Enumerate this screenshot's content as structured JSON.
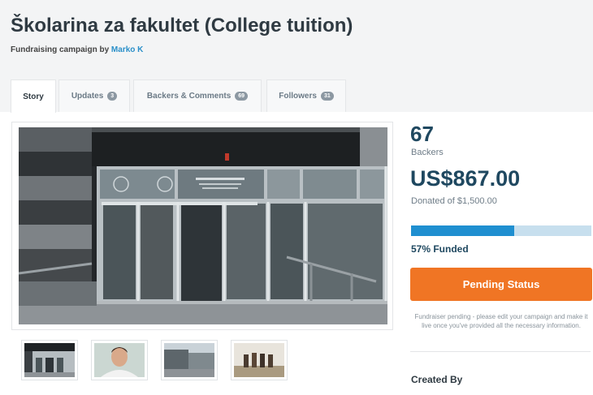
{
  "campaign": {
    "title": "Školarina za fakultet (College tuition)",
    "subtitle_prefix": "Fundraising campaign by",
    "author": "Marko K"
  },
  "tabs": [
    {
      "label": "Story",
      "badge": null,
      "active": true
    },
    {
      "label": "Updates",
      "badge": "3",
      "active": false
    },
    {
      "label": "Backers & Comments",
      "badge": "69",
      "active": false
    },
    {
      "label": "Followers",
      "badge": "31",
      "active": false
    }
  ],
  "sidebar": {
    "backers_count": "67",
    "backers_label": "Backers",
    "amount_raised": "US$867.00",
    "donated_of": "Donated of $1,500.00",
    "funded_fraction": 0.57,
    "funded_label": "57% Funded",
    "pending_button": "Pending Status",
    "pending_note": "Fundraiser pending - please edit your campaign and make it live once you've provided all the necessary information.",
    "created_by": "Created By"
  },
  "colors": {
    "accent_blue": "#1f8fd0",
    "button_orange": "#f07524",
    "link_blue": "#2a8fc9"
  }
}
